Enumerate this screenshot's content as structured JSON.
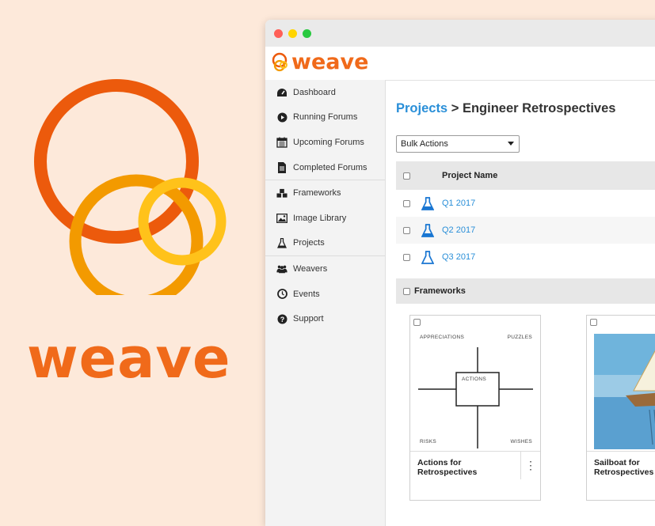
{
  "brand": {
    "wordmark": "weave"
  },
  "app": {
    "logo_text": "weave"
  },
  "sidebar": {
    "items": [
      {
        "label": "Dashboard",
        "icon": "dashboard-icon"
      },
      {
        "label": "Running Forums",
        "icon": "play-circle-icon"
      },
      {
        "label": "Upcoming Forums",
        "icon": "calendar-icon"
      },
      {
        "label": "Completed Forums",
        "icon": "document-icon"
      },
      {
        "label": "Frameworks",
        "icon": "cubes-icon"
      },
      {
        "label": "Image Library",
        "icon": "image-icon"
      },
      {
        "label": "Projects",
        "icon": "flask-icon"
      },
      {
        "label": "Weavers",
        "icon": "users-icon"
      },
      {
        "label": "Events",
        "icon": "clock-icon"
      },
      {
        "label": "Support",
        "icon": "question-icon"
      }
    ]
  },
  "breadcrumb": {
    "root": "Projects",
    "separator": ">",
    "current": "Engineer Retrospectives"
  },
  "bulk_actions": {
    "selected": "Bulk Actions"
  },
  "projects_table": {
    "header": "Project Name",
    "rows": [
      {
        "name": "Q1 2017"
      },
      {
        "name": "Q2 2017"
      },
      {
        "name": "Q3 2017"
      }
    ]
  },
  "frameworks": {
    "header": "Frameworks",
    "cards": [
      {
        "title": "Actions for Retrospectives",
        "menu": "⋮",
        "grid": {
          "top_left": "APPRECIATIONS",
          "top_right": "PUZZLES",
          "center": "ACTIONS",
          "bottom_left": "RISKS",
          "bottom_right": "WISHES"
        }
      },
      {
        "title": "Sailboat for Retrospectives"
      }
    ]
  },
  "colors": {
    "brand_orange": "#f06a1a",
    "link_blue": "#2a8fd8",
    "background": "#fde9da"
  }
}
